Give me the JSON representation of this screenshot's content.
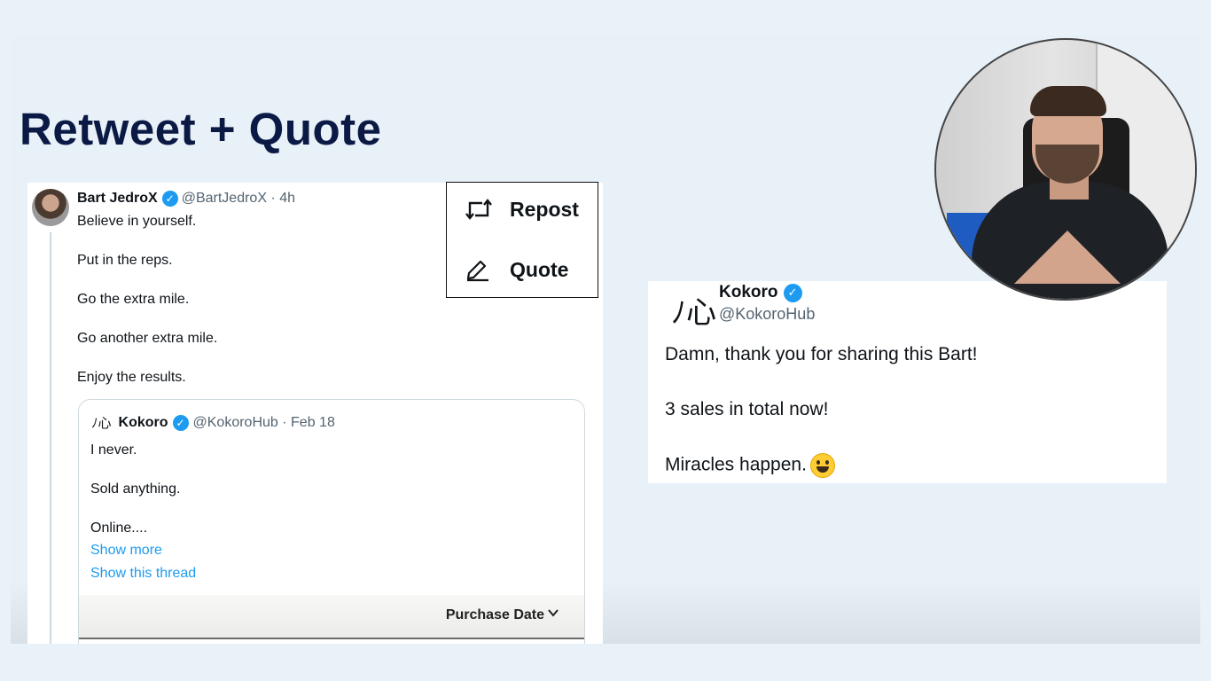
{
  "slide": {
    "title": "Retweet + Quote"
  },
  "tweet": {
    "author_name": "Bart JedroX",
    "author_handle_time": "@BartJedroX · 4h",
    "lines": [
      "Believe in yourself.",
      "Put in the reps.",
      "Go the extra mile.",
      "Go another extra mile.",
      "Enjoy the results."
    ],
    "quoted": {
      "logo": "ﾉ心",
      "name": "Kokoro",
      "handle_date": "@KokoroHub · Feb 18",
      "lines": [
        "I never.",
        "Sold anything.",
        "Online...."
      ],
      "show_more": "Show more",
      "show_thread": "Show this thread",
      "purchase_date_label": "Purchase Date"
    }
  },
  "menu": {
    "repost_label": "Repost",
    "quote_label": "Quote",
    "repost_icon": "repost-icon",
    "quote_icon": "pencil-icon"
  },
  "reply": {
    "logo": "ﾉ心",
    "name": "Kokoro",
    "handle": "@KokoroHub",
    "lines": [
      "Damn, thank you for sharing this Bart!",
      "3 sales in total now!",
      "Miracles happen."
    ],
    "emoji": "grinning-face-emoji"
  },
  "colors": {
    "accent": "#1d9bf0",
    "title": "#0b1a44",
    "slide_bg": "#e8f0f8"
  }
}
